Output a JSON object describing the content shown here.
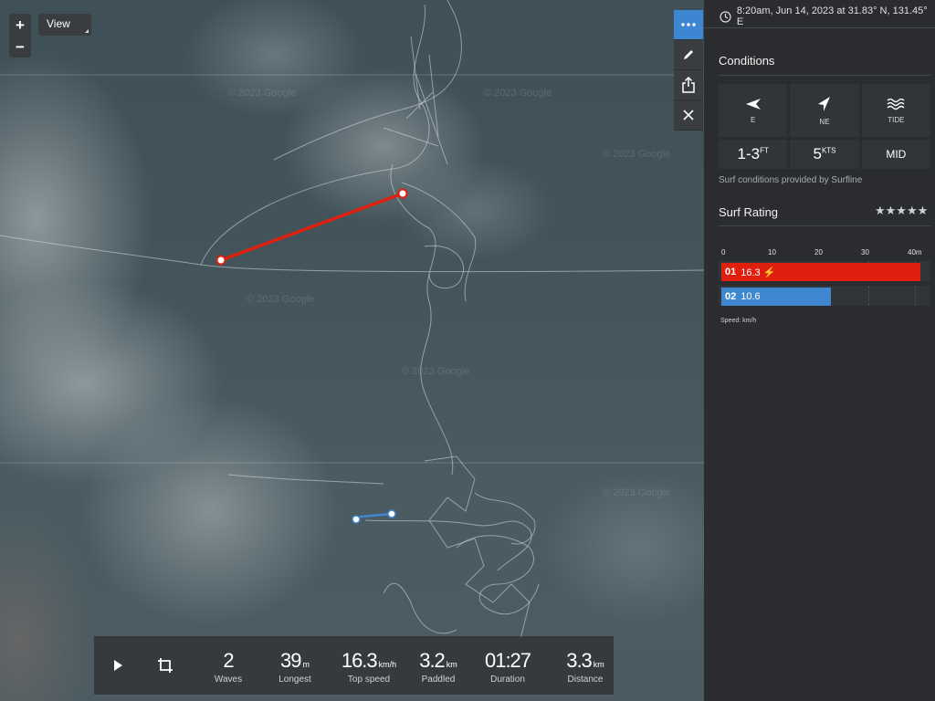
{
  "map": {
    "zoom_in_label": "+",
    "zoom_out_label": "−",
    "view_label": "View",
    "watermark": "© 2023 Google"
  },
  "toolbar": {
    "more_icon": "more-dots-icon",
    "edit_icon": "pencil-icon",
    "share_icon": "share-icon",
    "close_icon": "close-icon"
  },
  "stats": {
    "waves": {
      "value": "2",
      "unit": "",
      "label": "Waves"
    },
    "longest": {
      "value": "39",
      "unit": "m",
      "label": "Longest"
    },
    "top_speed": {
      "value": "16.3",
      "unit": "km/h",
      "label": "Top speed"
    },
    "paddled": {
      "value": "3.2",
      "unit": "km",
      "label": "Paddled"
    },
    "duration": {
      "value": "01:27",
      "unit": "",
      "label": "Duration"
    },
    "distance": {
      "value": "3.3",
      "unit": "km",
      "label": "Distance"
    }
  },
  "panel": {
    "timestamp": "8:20am, Jun 14, 2023 at 31.83° N, 131.45° E",
    "conditions_title": "Conditions",
    "conditions": [
      {
        "icon": "arrow-west-icon",
        "label": "E"
      },
      {
        "icon": "arrow-northeast-icon",
        "label": "NE"
      },
      {
        "icon": "tide-waves-icon",
        "label": "TIDE"
      }
    ],
    "swell_value": "1-3",
    "swell_unit": "FT",
    "wind_value": "5",
    "wind_unit": "KTS",
    "tide_value": "MID",
    "credit": "Surf conditions provided by Surfline",
    "rating_title": "Surf Rating",
    "rating_stars": "★★★★★",
    "speed_label": "Speed: km/h"
  },
  "colors": {
    "accent": "#3d86d1",
    "wave1": "#e0200f",
    "wave2": "#3f87cf",
    "panel_bg": "#2a2c2f"
  },
  "chart_data": {
    "type": "bar",
    "orientation": "horizontal",
    "x_ticks": [
      "0",
      "10",
      "20",
      "30",
      "40m"
    ],
    "xlim": [
      0,
      40
    ],
    "bars": [
      {
        "index": "01",
        "length": 39,
        "speed": "16.3",
        "top_speed_marker": "⚡",
        "color": "#e0200f"
      },
      {
        "index": "02",
        "length": 21.5,
        "speed": "10.6",
        "color": "#3f87cf"
      }
    ]
  }
}
